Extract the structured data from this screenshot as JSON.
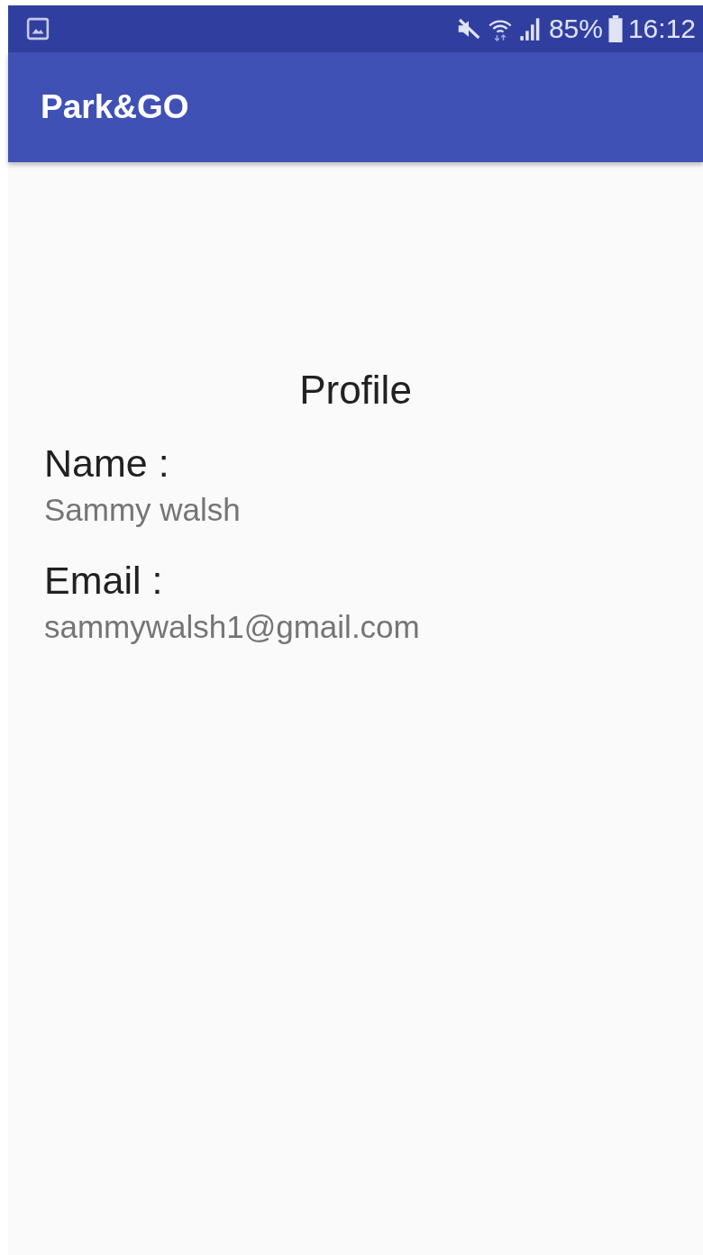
{
  "status_bar": {
    "battery": "85%",
    "time": "16:12"
  },
  "app_bar": {
    "title": "Park&GO"
  },
  "profile": {
    "title": "Profile",
    "fields": [
      {
        "label": "Name :",
        "value": "Sammy walsh"
      },
      {
        "label": "Email :",
        "value": "sammywalsh1@gmail.com"
      }
    ]
  }
}
